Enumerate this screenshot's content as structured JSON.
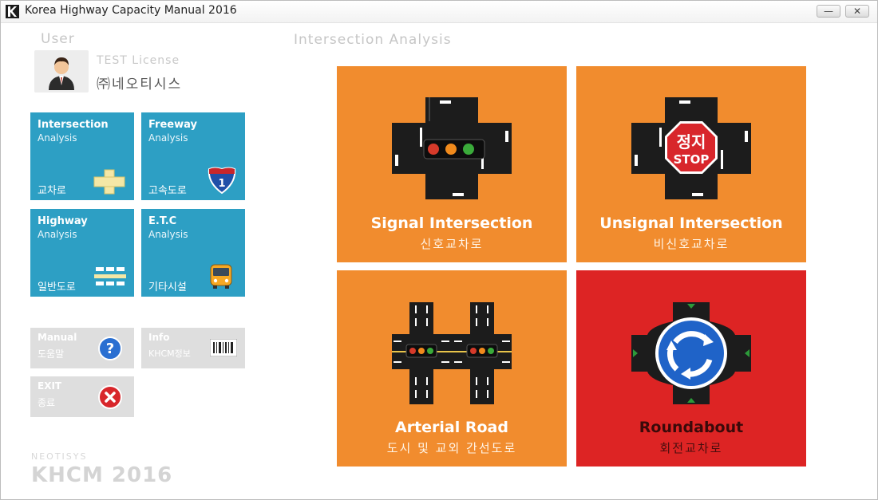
{
  "window": {
    "title": "Korea Highway Capacity Manual 2016",
    "minimize_label": "—",
    "close_label": "✕"
  },
  "user": {
    "heading": "User",
    "license": "TEST License",
    "company": "㈜네오티시스",
    "avatar_icon": "user-avatar-icon"
  },
  "main": {
    "heading": "Intersection Analysis"
  },
  "menu_tiles": [
    {
      "title": "Intersection",
      "subtitle": "Analysis",
      "korean": "교차로",
      "icon": "intersection-cross-icon"
    },
    {
      "title": "Freeway",
      "subtitle": "Analysis",
      "korean": "고속도로",
      "icon": "interstate-shield-icon",
      "shield_number": "1"
    },
    {
      "title": "Highway",
      "subtitle": "Analysis",
      "korean": "일반도로",
      "icon": "road-lanes-icon"
    },
    {
      "title": "E.T.C",
      "subtitle": "Analysis",
      "korean": "기타시설",
      "icon": "bus-icon"
    }
  ],
  "utility_tiles": {
    "manual": {
      "title": "Manual",
      "subtitle": "도움말",
      "icon": "help-icon"
    },
    "info": {
      "title": "Info",
      "subtitle": "KHCM정보",
      "icon": "barcode-icon"
    },
    "exit": {
      "title": "EXIT",
      "subtitle": "종료",
      "icon": "close-x-icon"
    }
  },
  "analysis_cards": [
    {
      "title": "Signal Intersection",
      "korean": "신호교차로",
      "icon": "traffic-light-intersection-icon"
    },
    {
      "title": "Unsignal Intersection",
      "korean": "비신호교차로",
      "icon": "stop-sign-intersection-icon",
      "sign_ko": "정지",
      "sign_en": "STOP"
    },
    {
      "title": "Arterial Road",
      "korean": "도시 및 교외 간선도로",
      "icon": "arterial-road-icon"
    },
    {
      "title": "Roundabout",
      "korean": "회전교차로",
      "icon": "roundabout-icon"
    }
  ],
  "footer": {
    "brand_small": "NEOTISYS",
    "brand_big": "KHCM 2016"
  },
  "colors": {
    "tile_blue": "#2d9fc4",
    "card_orange": "#f18c2e",
    "card_red": "#dd2424",
    "utility_gray": "#dedede"
  }
}
